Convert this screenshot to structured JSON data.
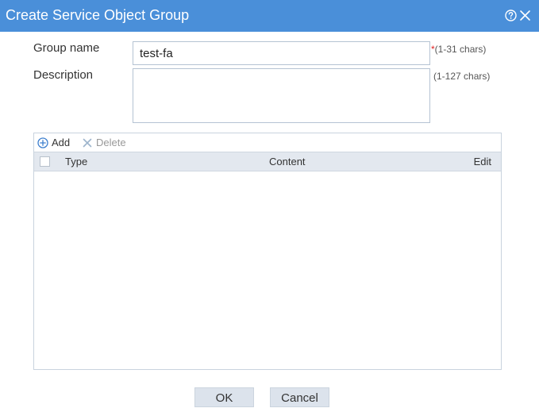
{
  "dialog": {
    "title": "Create Service Object Group",
    "help_icon": "help-circle-icon",
    "close_icon": "close-x-icon"
  },
  "form": {
    "group_name": {
      "label": "Group name",
      "value": "test-fa",
      "required_mark": "*",
      "hint": "(1-31 chars)"
    },
    "description": {
      "label": "Description",
      "value": "",
      "hint": "(1-127 chars)"
    }
  },
  "grid": {
    "toolbar": {
      "add_label": "Add",
      "add_icon": "plus-circle-icon",
      "delete_label": "Delete",
      "delete_icon": "x-icon",
      "delete_disabled": true
    },
    "columns": [
      "Type",
      "Content",
      "Edit"
    ],
    "rows": []
  },
  "footer": {
    "ok_label": "OK",
    "cancel_label": "Cancel"
  },
  "colors": {
    "title_bar": "#4a8fd9",
    "header_row": "#e3e8ef",
    "button": "#dce3ec",
    "required": "#e02020"
  }
}
